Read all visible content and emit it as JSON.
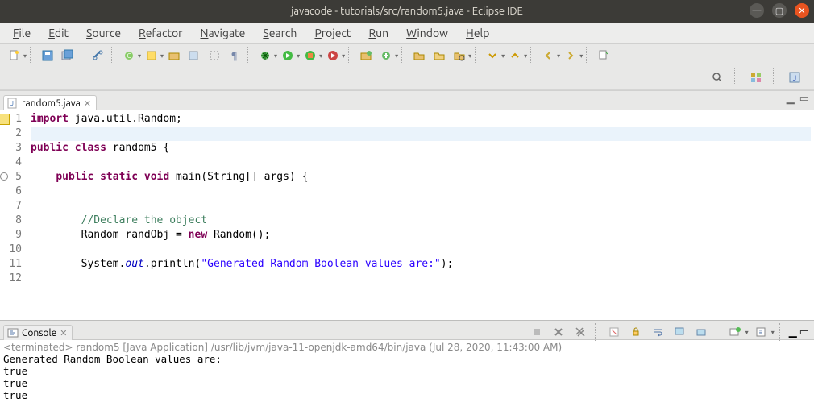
{
  "window": {
    "title": "javacode - tutorials/src/random5.java - Eclipse IDE"
  },
  "menu": {
    "items": [
      "File",
      "Edit",
      "Source",
      "Refactor",
      "Navigate",
      "Search",
      "Project",
      "Run",
      "Window",
      "Help"
    ]
  },
  "editor_tab": {
    "filename": "random5.java",
    "close_glyph": "✕"
  },
  "code": {
    "lines": [
      {
        "n": 1,
        "segments": [
          [
            "kw",
            "import"
          ],
          [
            "",
            " java.util.Random;"
          ]
        ]
      },
      {
        "n": 2,
        "segments": [
          [
            "",
            ""
          ]
        ],
        "current": true,
        "caret": true
      },
      {
        "n": 3,
        "segments": [
          [
            "kw",
            "public"
          ],
          [
            "",
            " "
          ],
          [
            "kw",
            "class"
          ],
          [
            "",
            " random5 {"
          ]
        ]
      },
      {
        "n": 4,
        "segments": [
          [
            "",
            ""
          ]
        ]
      },
      {
        "n": 5,
        "segments": [
          [
            "",
            "    "
          ],
          [
            "kw",
            "public"
          ],
          [
            "",
            " "
          ],
          [
            "kw",
            "static"
          ],
          [
            "",
            " "
          ],
          [
            "kw",
            "void"
          ],
          [
            "",
            " main(String[] args) {"
          ]
        ],
        "foldmark": true
      },
      {
        "n": 6,
        "segments": [
          [
            "",
            ""
          ]
        ]
      },
      {
        "n": 7,
        "segments": [
          [
            "",
            ""
          ]
        ]
      },
      {
        "n": 8,
        "segments": [
          [
            "",
            "        "
          ],
          [
            "com",
            "//Declare the object"
          ]
        ]
      },
      {
        "n": 9,
        "segments": [
          [
            "",
            "        Random randObj = "
          ],
          [
            "kw",
            "new"
          ],
          [
            "",
            " Random();"
          ]
        ]
      },
      {
        "n": 10,
        "segments": [
          [
            "",
            ""
          ]
        ]
      },
      {
        "n": 11,
        "segments": [
          [
            "",
            "        System."
          ],
          [
            "fld",
            "out"
          ],
          [
            "",
            ".println("
          ],
          [
            "str",
            "\"Generated Random Boolean values are:\""
          ],
          [
            "",
            ");"
          ]
        ]
      },
      {
        "n": 12,
        "segments": [
          [
            "",
            ""
          ]
        ]
      }
    ]
  },
  "console": {
    "tab_label": "Console",
    "header": "<terminated> random5 [Java Application] /usr/lib/jvm/java-11-openjdk-amd64/bin/java (Jul 28, 2020, 11:43:00 AM)",
    "output": [
      "Generated Random Boolean values are:",
      "true",
      "true",
      "true"
    ]
  },
  "icons": {
    "minimize": "—",
    "maximize": "▢",
    "close": "✕",
    "tab_maximize": "▭",
    "tab_minimize": "▁"
  }
}
